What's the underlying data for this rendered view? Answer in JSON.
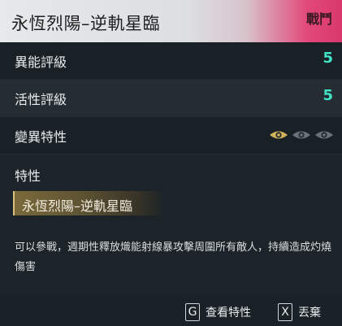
{
  "header": {
    "title": "永恆烈陽–逆軌星臨",
    "tag": "戰鬥"
  },
  "rows": [
    {
      "label": "異能評級",
      "value": "5"
    },
    {
      "label": "活性評級",
      "value": "5"
    },
    {
      "label": "變異特性",
      "eyes": [
        "active",
        "inactive",
        "inactive"
      ]
    }
  ],
  "trait_section": {
    "title": "特性",
    "trait_name": "永恆烈陽–逆軌星臨",
    "description": "可以參戰，週期性釋放熾能射線暴攻擊周圍所有敵人，持續造成灼燒傷害"
  },
  "footer": {
    "view_key": "G",
    "view_label": "查看特性",
    "discard_key": "X",
    "discard_label": "丟棄"
  },
  "colors": {
    "accent_teal": "#3fe3c6",
    "header_pink": "#e2487a",
    "eye_active": "#d2b25a",
    "eye_inactive": "#6b7278"
  }
}
